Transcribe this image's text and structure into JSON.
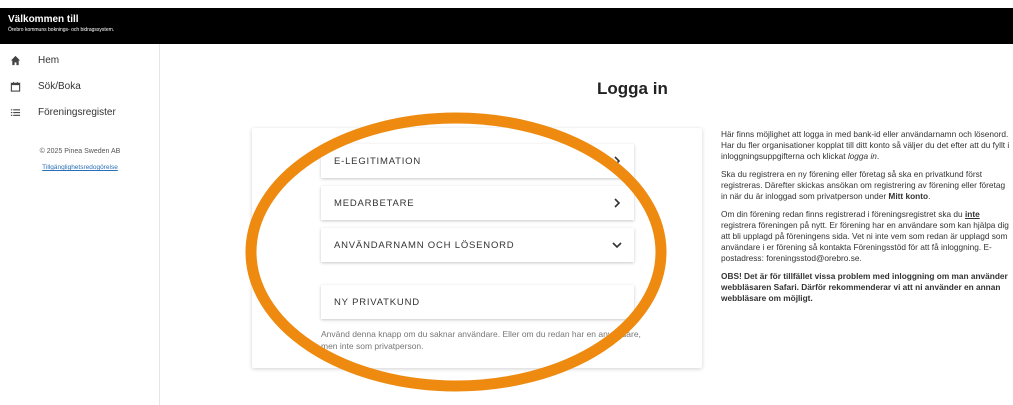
{
  "header": {
    "title": "Välkommen till",
    "subtitle": "Örebro kommuns boknings- och bidragssystem."
  },
  "sidebar": {
    "items": [
      {
        "label": "Hem",
        "icon": "home-icon"
      },
      {
        "label": "Sök/Boka",
        "icon": "calendar-icon"
      },
      {
        "label": "Föreningsregister",
        "icon": "list-icon"
      }
    ],
    "copyright": "© 2025 Pinea Sweden AB",
    "accessibility_link": "Tillgänglighetsredogörelse"
  },
  "main": {
    "title": "Logga in",
    "options": [
      {
        "label": "E-LEGITIMATION",
        "chevron": "chevron-right-icon"
      },
      {
        "label": "MEDARBETARE",
        "chevron": "chevron-right-icon"
      },
      {
        "label": "ANVÄNDARNAMN OCH LÖSENORD",
        "chevron": "chevron-down-icon"
      },
      {
        "label": "NY PRIVATKUND"
      }
    ],
    "hint": "Använd denna knapp om du saknar användare. Eller om du redan har en användare, men inte som privatperson."
  },
  "info": {
    "p1_a": "Här finns möjlighet att logga in med bank-id eller användarnamn och lösenord. Har du fler organisationer kopplat till ditt konto så väljer du det efter att du fyllt i inloggningsuppgifterna och klickat ",
    "p1_em": "logga in",
    "p1_b": ".",
    "p2_a": "Ska du registrera en ny förening eller företag så ska en privatkund först registreras. Därefter skickas ansökan om registrering av förening eller företag in när du är inloggad som privatperson under ",
    "p2_strong": "Mitt konto",
    "p2_b": ".",
    "p3_a": "Om din förening redan finns registrerad i föreningsregistret ska du ",
    "p3_strong": "inte",
    "p3_b": " registrera föreningen på nytt. Er förening har en användare som kan hjälpa dig att bli upplagd på föreningens sida. Vet ni inte vem som redan är upplagd som användare i er förening så kontakta Föreningsstöd för att få inloggning. E-postadress: foreningsstod@orebro.se.",
    "p4": "OBS! Det är för tillfället vissa problem med inloggning om man använder webbläsaren Safari. Därför rekommenderar vi att ni använder en annan webbläsare om möjligt."
  },
  "colors": {
    "header_bg": "#000000",
    "annotation_ring": "#ee8a10",
    "link": "#2a6fb6"
  }
}
